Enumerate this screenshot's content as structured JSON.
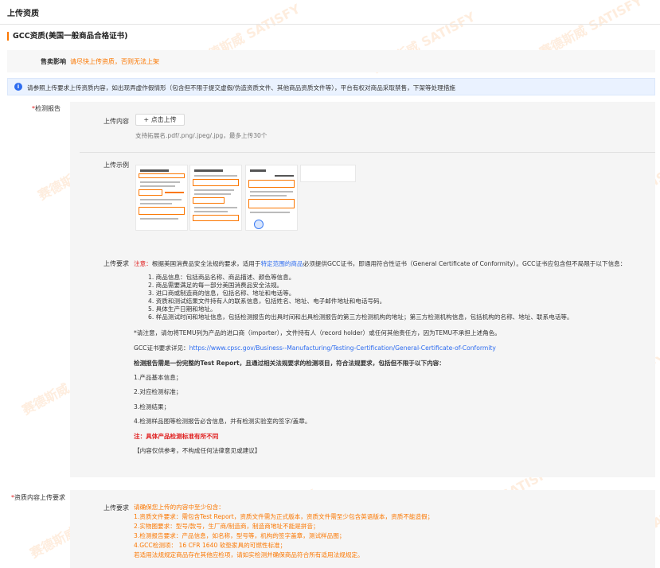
{
  "page": {
    "title": "上传资质"
  },
  "section": {
    "title": "GCC资质(美国一般商品合格证书)"
  },
  "impact": {
    "label": "售卖影响",
    "text": "请尽快上传资质，否则无法上架"
  },
  "info": {
    "icon": "info-icon",
    "text": "请参照上传要求上传资质内容，如出现弄虚作假情形（包含但不限于提交虚假/伪造资质文件、其他商品资质文件等），平台有权对商品采取禁售，下架等处理措施"
  },
  "test_report": {
    "star": "*",
    "label": "检测报告",
    "upload_label": "上传内容",
    "upload_button": "+ 点击上传",
    "upload_hint": "支持拓展名.pdf/.png/.jpeg/.jpg，最多上传30个",
    "example_label": "上传示例",
    "requirement_label": "上传要求",
    "note_prefix": "注意：",
    "note_a": "根据美国消费品安全法规的要求，适用于",
    "note_link": "特定范围的商品",
    "note_b": "必须提供GCC证书，即通用符合性证书（General Certificate of Conformity）。GCC证书应包含但不局限于以下信息：",
    "items": [
      "1. 商品信息：包括商品名称、商品描述、颜色等信息。",
      "2. 商品需要满足的每一部分美国消费品安全法规。",
      "3. 进口商或制造商的信息，包括名称、地址和电话等。",
      "4. 资质和测试结果文件持有人的联系信息，包括姓名、地址、电子邮件地址和电话号码。",
      "5. 具体生产日期和地址。",
      "6. 样品测试时间和地址信息，包括检测报告的出具时间和出具检测报告的第三方检测机构的地址；第三方检测机构信息，包括机构的名称、地址、联系电话等。"
    ],
    "importer_note": "*请注意，请勿将TEMU列为产品的进口商（importer），文件持有人（record holder）或任何其他责任方，因为TEMU不承担上述角色。",
    "gcc_detail_prefix": "GCC证书要求详见：",
    "gcc_detail_link": "https://www.cpsc.gov/Business--Manufacturing/Testing-Certification/General-Certificate-of-Conformity",
    "report_intro": "检测报告需是一份完整的Test Report，且通过相关法规要求的检测项目，符合法规要求，包括但不限于以下内容：",
    "report_items": [
      "1.产品基本信息；",
      "2.对应检测标准；",
      "3.检测结果；",
      "4.检测样品图等检测报告必含信息，并有检测实验室的签字/盖章。"
    ],
    "red_note": "注：具体产品检测标准有所不同",
    "disclaimer": "【内容仅供参考，不构成任何法律意见或建议】"
  },
  "content_req": {
    "star": "*",
    "label": "资质内容上传要求",
    "requirement_label": "上传要求",
    "lines": [
      "请确保您上传的内容中至少包含：",
      "1.资质文件要求：需包含Test Report，资质文件需为正式版本，资质文件需至少包含英语版本，资质不能造假；",
      "2.实物图要求：型号/款号，生厂商/制造商，制造商地址不能是拼音；",
      "3.检测报告要求：产品信息，如名称，型号等，机构的签字盖章，测试样品图；",
      "4.GCC检测项： 16 CFR 1640 软垫家具的可燃性标准；",
      "若适用法规规定商品存在其他应检项，请如实检测并确保商品符合所有适用法规规定。"
    ]
  },
  "watermark": {
    "text": "赛德斯威 SATISFY"
  },
  "colors": {
    "accent": "#fb7701",
    "link": "#2d6cf0",
    "danger": "#e02020",
    "info_bg": "#eaf2ff"
  }
}
